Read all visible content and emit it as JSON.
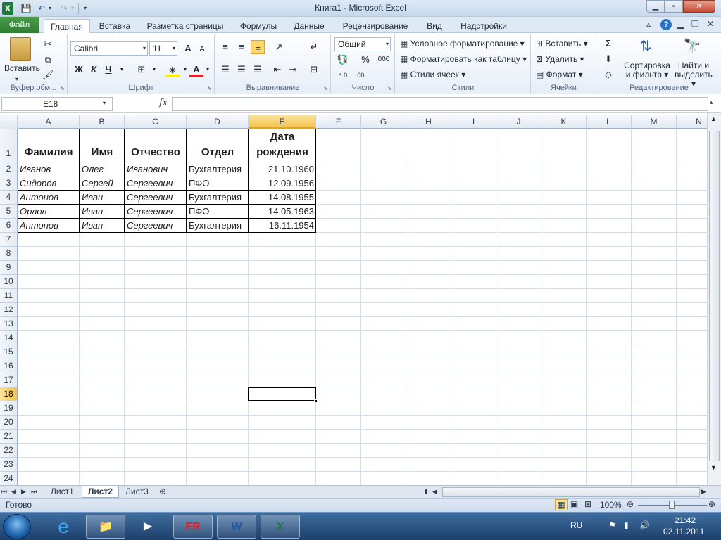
{
  "window": {
    "title": "Книга1  -  Microsoft Excel",
    "app_icon": "X"
  },
  "qat": {
    "save": "💾",
    "undo": "↶",
    "redo": "↷",
    "dropdown": "▾"
  },
  "ribbon_tabs": [
    {
      "label": "Файл"
    },
    {
      "label": "Главная"
    },
    {
      "label": "Вставка"
    },
    {
      "label": "Разметка страницы"
    },
    {
      "label": "Формулы"
    },
    {
      "label": "Данные"
    },
    {
      "label": "Рецензирование"
    },
    {
      "label": "Вид"
    },
    {
      "label": "Надстройки"
    }
  ],
  "ribbon": {
    "clipboard": {
      "label": "Буфер обм...",
      "paste": "Вставить"
    },
    "font": {
      "label": "Шрифт",
      "name": "Calibri",
      "size": "11",
      "bold": "Ж",
      "italic": "К",
      "underline": "Ч",
      "grow": "A",
      "shrink": "A",
      "color_letter": "A"
    },
    "alignment": {
      "label": "Выравнивание"
    },
    "number": {
      "label": "Число",
      "format": "Общий",
      "percent": "%",
      "thousands": "000"
    },
    "styles": {
      "label": "Стили",
      "conditional": "Условное форматирование",
      "as_table": "Форматировать как таблицу",
      "cell_styles": "Стили ячеек"
    },
    "cells": {
      "label": "Ячейки",
      "insert": "Вставить",
      "delete": "Удалить",
      "format": "Формат"
    },
    "editing": {
      "label": "Редактирование",
      "sort_line1": "Сортировка",
      "sort_line2": "и фильтр",
      "find_line1": "Найти и",
      "find_line2": "выделить",
      "sum": "Σ"
    }
  },
  "formula_bar": {
    "name_box": "E18",
    "fx": "fx",
    "formula": ""
  },
  "columns": [
    "A",
    "B",
    "C",
    "D",
    "E",
    "F",
    "G",
    "H",
    "I",
    "J",
    "K",
    "L",
    "M",
    "N"
  ],
  "rows": [
    "1",
    "2",
    "3",
    "4",
    "5",
    "6",
    "7",
    "8",
    "9",
    "10",
    "11",
    "12",
    "13",
    "14",
    "15",
    "16",
    "17",
    "18",
    "19",
    "20",
    "21",
    "22",
    "23",
    "24"
  ],
  "selected": {
    "column": "E",
    "row": "18"
  },
  "table": {
    "headers": [
      "Фамилия",
      "Имя",
      "Отчество",
      "Отдел",
      "Дата",
      "рождения"
    ],
    "rows": [
      [
        "Иванов",
        "Олег",
        "Иванович",
        "Бухгалтерия",
        "21.10.1960"
      ],
      [
        "Сидоров",
        "Сергей",
        "Сергеевич",
        "ПФО",
        "12.09.1956"
      ],
      [
        "Антонов",
        "Иван",
        "Сергеевич",
        "Бухгалтерия",
        "14.08.1955"
      ],
      [
        "Орлов",
        "Иван",
        "Сергеевич",
        "ПФО",
        "14.05.1963"
      ],
      [
        "Антонов",
        "Иван",
        "Сергеевич",
        "Бухгалтерия",
        "16.11.1954"
      ]
    ]
  },
  "sheets": {
    "tab1": "Лист1",
    "tab2": "Лист2",
    "tab3": "Лист3"
  },
  "status": {
    "ready": "Готово",
    "zoom": "100%"
  },
  "taskbar": {
    "language": "RU",
    "time": "21:42",
    "date": "02.11.2011"
  }
}
